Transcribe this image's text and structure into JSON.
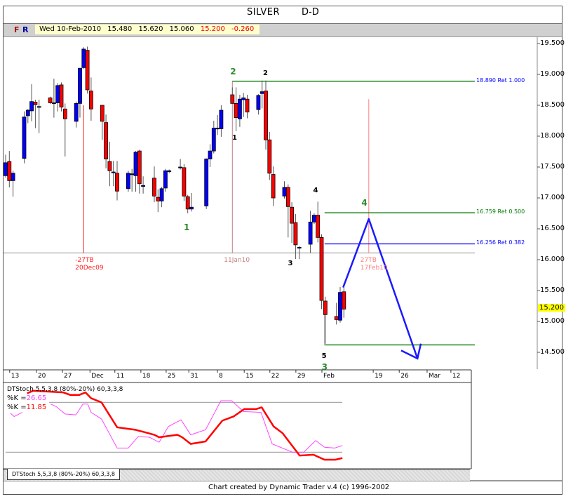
{
  "header": {
    "title": "SILVER",
    "period": "D-D",
    "f_button": "F",
    "r_button": "R"
  },
  "quote": {
    "date": "Wed 10-Feb-2010",
    "open": "15.480",
    "high": "15.620",
    "low": "15.060",
    "close": "15.200",
    "change": "-0.260"
  },
  "colors": {
    "up": "#0000ff",
    "down": "#ff0000",
    "stoch_k1": "#ff44ff",
    "stoch_k2": "#ff0000",
    "ret_green": "#007a00",
    "ret_blue": "#0000ff",
    "last_price_bg": "#ffff00"
  },
  "price_axis": {
    "labels": [
      "19.500",
      "19.000",
      "18.500",
      "18.000",
      "17.500",
      "17.000",
      "16.500",
      "16.000",
      "15.500",
      "15.000",
      "14.500"
    ],
    "last_price": "15.200"
  },
  "chart_data": {
    "type": "candlestick",
    "title": "SILVER D-D",
    "ylim": [
      14.3,
      19.6
    ],
    "x_unit": "calendar days from first bar",
    "x_ticks": [
      {
        "label": "13",
        "d": 2.6
      },
      {
        "label": "20",
        "d": 9.8
      },
      {
        "label": "27",
        "d": 16.8
      },
      {
        "label": "Dec",
        "d": 24.2
      },
      {
        "label": "11",
        "d": 30.9
      },
      {
        "label": "18",
        "d": 37.9
      },
      {
        "label": "25",
        "d": 44.7
      },
      {
        "label": "31",
        "d": 50.8
      },
      {
        "label": "8",
        "d": 58.5
      },
      {
        "label": "15",
        "d": 65.7
      },
      {
        "label": "22",
        "d": 72.6
      },
      {
        "label": "29",
        "d": 79.6
      },
      {
        "label": "Feb",
        "d": 86.6
      },
      {
        "label": "19",
        "d": 100.4
      },
      {
        "label": "26",
        "d": 107.4
      },
      {
        "label": "Mar",
        "d": 114.9
      },
      {
        "label": "12",
        "d": 121.3
      }
    ],
    "candles": [
      [
        0,
        17.36,
        17.7,
        17.33,
        17.57
      ],
      [
        1,
        17.59,
        17.76,
        17.17,
        17.28
      ],
      [
        2,
        17.28,
        17.44,
        17.02,
        17.4
      ],
      [
        5,
        17.64,
        18.4,
        17.56,
        18.31
      ],
      [
        6,
        18.33,
        18.44,
        18.21,
        18.42
      ],
      [
        7,
        18.41,
        18.84,
        18.24,
        18.56
      ],
      [
        8,
        18.55,
        18.59,
        18.13,
        18.51
      ],
      [
        9,
        18.48,
        18.59,
        18.05,
        18.48
      ],
      [
        12,
        18.62,
        18.64,
        18.52,
        18.54
      ],
      [
        13,
        18.54,
        18.93,
        18.3,
        18.54
      ],
      [
        14,
        18.54,
        18.86,
        18.4,
        18.82
      ],
      [
        15,
        18.83,
        18.87,
        18.4,
        18.47
      ],
      [
        16,
        18.44,
        18.53,
        17.67,
        18.28
      ],
      [
        19,
        18.24,
        18.56,
        18.14,
        18.53
      ],
      [
        20,
        18.53,
        19.1,
        18.3,
        19.1
      ],
      [
        21,
        19.11,
        19.44,
        19.09,
        19.41
      ],
      [
        22,
        19.39,
        19.45,
        18.69,
        18.75
      ],
      [
        23,
        18.73,
        18.95,
        18.25,
        18.44
      ],
      [
        26,
        18.5,
        18.5,
        17.94,
        18.24
      ],
      [
        27,
        18.22,
        18.35,
        17.48,
        17.63
      ],
      [
        28,
        17.59,
        17.91,
        17.19,
        17.44
      ],
      [
        29,
        17.42,
        17.6,
        17.19,
        17.42
      ],
      [
        30,
        17.4,
        17.6,
        16.96,
        17.11
      ],
      [
        33,
        17.15,
        17.44,
        17.1,
        17.4
      ],
      [
        34,
        17.39,
        17.47,
        17.1,
        17.39
      ],
      [
        35,
        17.36,
        17.76,
        17.1,
        17.74
      ],
      [
        36,
        17.76,
        17.78,
        17.07,
        17.23
      ],
      [
        37,
        17.2,
        17.35,
        17.07,
        17.2
      ],
      [
        40,
        17.32,
        17.51,
        16.93,
        17.03
      ],
      [
        41,
        17.01,
        17.14,
        16.77,
        16.95
      ],
      [
        42,
        16.95,
        17.18,
        16.85,
        17.15
      ],
      [
        43,
        17.16,
        17.47,
        17.1,
        17.44
      ],
      [
        44,
        17.44,
        17.46,
        17.4,
        17.44
      ],
      [
        47,
        17.5,
        17.63,
        17.46,
        17.5
      ],
      [
        48,
        17.49,
        17.55,
        16.95,
        17.03
      ],
      [
        49,
        17.02,
        17.05,
        16.75,
        16.82
      ],
      [
        50,
        16.82,
        17.08,
        16.78,
        16.85
      ],
      [
        54,
        16.87,
        17.64,
        16.82,
        17.63
      ],
      [
        55,
        17.63,
        17.87,
        17.5,
        17.76
      ],
      [
        56,
        17.76,
        18.25,
        17.72,
        18.13
      ],
      [
        57,
        18.13,
        18.34,
        18.02,
        18.13
      ],
      [
        58,
        18.12,
        18.5,
        17.99,
        18.42
      ],
      [
        61,
        18.67,
        18.79,
        18.53,
        18.53
      ],
      [
        62,
        18.53,
        18.79,
        18.08,
        18.3
      ],
      [
        63,
        18.28,
        18.67,
        18.15,
        18.6
      ],
      [
        64,
        18.59,
        18.7,
        18.31,
        18.62
      ],
      [
        65,
        18.6,
        18.67,
        18.29,
        18.39
      ],
      [
        68,
        18.43,
        18.68,
        18.35,
        18.66
      ],
      [
        69,
        18.69,
        18.9,
        18.45,
        18.72
      ],
      [
        70,
        18.73,
        18.9,
        17.78,
        17.94
      ],
      [
        71,
        17.94,
        18.07,
        17.29,
        17.4
      ],
      [
        72,
        17.38,
        17.51,
        16.87,
        17.0
      ],
      [
        75,
        17.03,
        17.27,
        16.99,
        17.17
      ],
      [
        76,
        17.17,
        17.22,
        16.36,
        16.86
      ],
      [
        77,
        16.85,
        16.93,
        16.27,
        16.59
      ],
      [
        78,
        16.6,
        16.74,
        16.01,
        16.24
      ],
      [
        79,
        16.2,
        16.22,
        16.01,
        16.2
      ],
      [
        82,
        16.25,
        16.79,
        16.11,
        16.61
      ],
      [
        83,
        16.61,
        16.75,
        16.58,
        16.72
      ],
      [
        84,
        16.72,
        16.94,
        16.28,
        16.36
      ],
      [
        85,
        16.36,
        16.41,
        15.2,
        15.34
      ],
      [
        86,
        15.33,
        15.4,
        14.64,
        15.11
      ],
      [
        89,
        15.08,
        15.3,
        14.95,
        15.03
      ],
      [
        90,
        15.02,
        15.56,
        14.98,
        15.47
      ],
      [
        91,
        15.48,
        15.62,
        15.06,
        15.2
      ]
    ],
    "retracements": [
      {
        "label": "18.890 Ret 1.000",
        "price": 18.89,
        "from_d": 61,
        "color": "#007a00",
        "label_color": "#0000ff"
      },
      {
        "label": "16.759 Ret 0.500",
        "price": 16.759,
        "from_d": 85.8,
        "color": "#007a00",
        "label_color": "#007a00"
      },
      {
        "label": "16.256 Ret 0.382",
        "price": 16.256,
        "from_d": 85.8,
        "color": "#0000ff",
        "label_color": "#0000ff"
      },
      {
        "label": "",
        "price": 14.62,
        "from_d": 85.8,
        "color": "#007a00",
        "label_color": "#007a00"
      }
    ],
    "time_markers": [
      {
        "label1": "-27TB",
        "label2": "20Dec09",
        "d": 21,
        "top": 18.5,
        "color": "#ff2020"
      },
      {
        "label1": "11Jan10",
        "label2": "",
        "d": 61,
        "top": 18.89,
        "color": "#c08080"
      },
      {
        "label1": "27TB",
        "label2": "17Feb10",
        "d": 97.7,
        "top": 18.6,
        "color": "#ff8080"
      }
    ],
    "wave_labels": [
      {
        "text": "2",
        "d": 61,
        "p": 19.05,
        "color": "#2a8a2a"
      },
      {
        "text": "2",
        "d": 69.8,
        "p": 19.0,
        "color": "#000"
      },
      {
        "text": "1",
        "d": 61.5,
        "p": 17.95,
        "color": "#000"
      },
      {
        "text": "1",
        "d": 48.5,
        "p": 16.52,
        "color": "#2a8a2a"
      },
      {
        "text": "3",
        "d": 76.5,
        "p": 15.92,
        "color": "#000"
      },
      {
        "text": "4",
        "d": 83.3,
        "p": 17.1,
        "color": "#000"
      },
      {
        "text": "4",
        "d": 96.3,
        "p": 16.92,
        "color": "#2a8a2a"
      },
      {
        "text": "5",
        "d": 85.6,
        "p": 14.42,
        "color": "#000"
      },
      {
        "text": "3",
        "d": 85.6,
        "p": 14.26,
        "color": "#2a8a2a"
      }
    ],
    "projection_arrow": [
      [
        90.8,
        15.55
      ],
      [
        97.7,
        16.66
      ],
      [
        110.8,
        14.4
      ]
    ],
    "arrow_head": [
      [
        106.4,
        14.53
      ],
      [
        110.8,
        14.4
      ],
      [
        111.7,
        14.64
      ]
    ],
    "stochastic": {
      "title": "DTStoch 5,5,3,8 (80%-20%) 60,3,3,8",
      "k1_label": "%K =",
      "k1_value": "26.65",
      "k2_label": "%K =",
      "k2_value": "11.85",
      "levels": [
        80,
        20
      ],
      "k1_segments": [
        [
          [
            1.3,
            67
          ],
          [
            2.3,
            63
          ],
          [
            4.5,
            68
          ]
        ],
        [
          [
            12.1,
            78
          ],
          [
            13.6,
            75
          ],
          [
            16,
            66
          ],
          [
            18.9,
            65
          ],
          [
            20.8,
            78
          ],
          [
            22.1,
            78
          ],
          [
            23,
            68
          ],
          [
            25.8,
            60
          ],
          [
            30,
            25
          ],
          [
            33,
            25
          ],
          [
            35.7,
            39
          ],
          [
            38.7,
            38
          ],
          [
            41.3,
            32
          ],
          [
            43.8,
            51
          ],
          [
            47.2,
            59
          ],
          [
            49.8,
            41
          ],
          [
            53.8,
            47
          ],
          [
            57.9,
            82
          ],
          [
            60.8,
            82
          ],
          [
            64,
            69
          ],
          [
            68.7,
            68
          ],
          [
            71.7,
            30
          ],
          [
            77.2,
            20
          ],
          [
            80.2,
            20
          ],
          [
            83.4,
            34
          ],
          [
            85.8,
            26
          ],
          [
            88.5,
            25
          ],
          [
            90.6,
            28
          ]
        ]
      ],
      "k2": [
        [
          5.8,
          91
        ],
        [
          7.4,
          94
        ],
        [
          15.5,
          92
        ],
        [
          17.4,
          89
        ],
        [
          19.8,
          89
        ],
        [
          21.5,
          92
        ],
        [
          23,
          85
        ],
        [
          25.8,
          80
        ],
        [
          30,
          50
        ],
        [
          34.9,
          47
        ],
        [
          37.5,
          44
        ],
        [
          40,
          41
        ],
        [
          41.3,
          38
        ],
        [
          46.2,
          41
        ],
        [
          47.5,
          38
        ],
        [
          49.8,
          30
        ],
        [
          53.8,
          33
        ],
        [
          58.3,
          58
        ],
        [
          61.3,
          63
        ],
        [
          64.2,
          72
        ],
        [
          67.4,
          72
        ],
        [
          68.9,
          74
        ],
        [
          72.1,
          51
        ],
        [
          74.5,
          43
        ],
        [
          79.1,
          16
        ],
        [
          82.8,
          17
        ],
        [
          85.8,
          11
        ],
        [
          88.7,
          11
        ],
        [
          90.6,
          13
        ]
      ]
    }
  },
  "footer": {
    "tab_label": "DTStoch 5,5,3,8 (80%-20%) 60,3,3,8",
    "credit": "Chart created by Dynamic Trader v.4  (c) 1996-2002"
  }
}
